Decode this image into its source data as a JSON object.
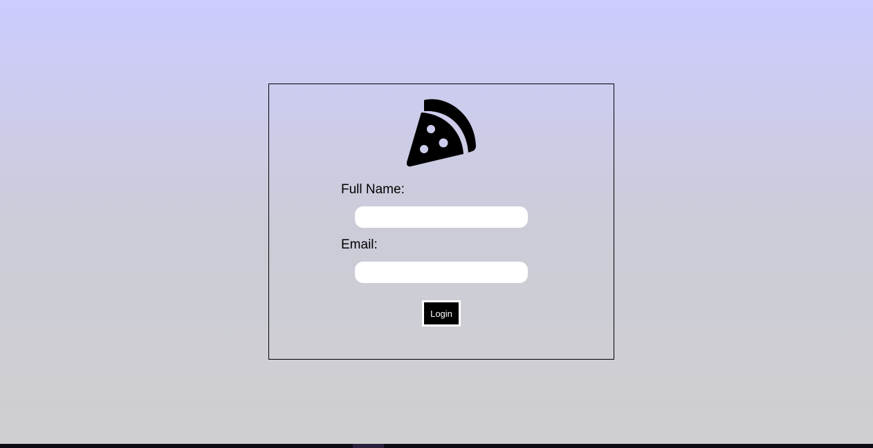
{
  "colors": {
    "background_top": "#ccccff",
    "background_bottom": "#cfcfd1",
    "box_border": "#000000",
    "button_bg": "#000000",
    "button_text": "#ffffff",
    "input_bg": "#ffffff"
  },
  "logo": {
    "icon": "pizza-slice-icon"
  },
  "form": {
    "full_name_label": "Full Name:",
    "full_name_value": "",
    "email_label": "Email:",
    "email_value": "",
    "login_label": "Login"
  }
}
